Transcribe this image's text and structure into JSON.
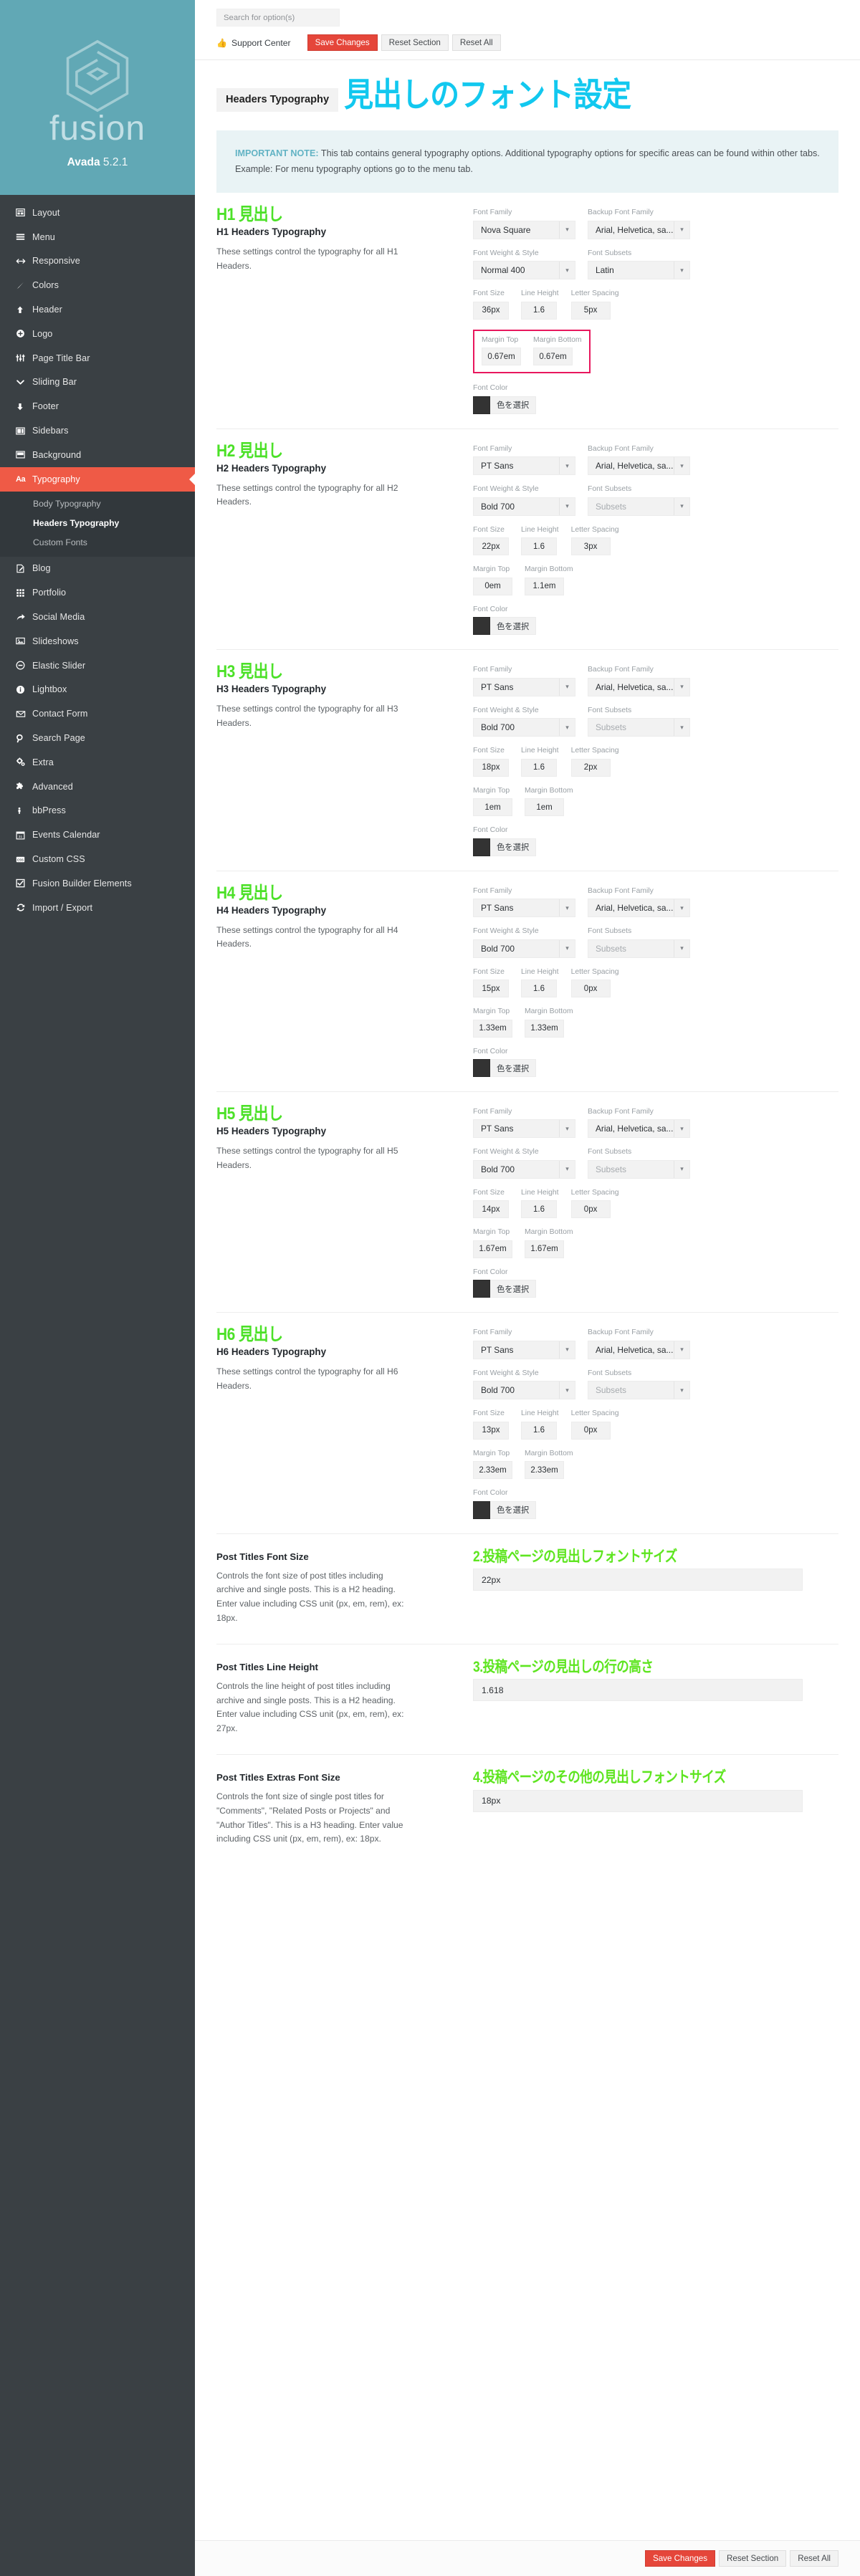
{
  "brand": {
    "name": "Avada",
    "version": "5.2.1",
    "wordmark": "fusion"
  },
  "sidebar": {
    "items": [
      {
        "label": "Layout",
        "icon": "layout-icon"
      },
      {
        "label": "Menu",
        "icon": "menu-icon"
      },
      {
        "label": "Responsive",
        "icon": "responsive-icon"
      },
      {
        "label": "Colors",
        "icon": "brush-icon"
      },
      {
        "label": "Header",
        "icon": "arrow-up-icon"
      },
      {
        "label": "Logo",
        "icon": "plus-circle-icon"
      },
      {
        "label": "Page Title Bar",
        "icon": "sliders-icon"
      },
      {
        "label": "Sliding Bar",
        "icon": "chevron-down-icon"
      },
      {
        "label": "Footer",
        "icon": "arrow-down-icon"
      },
      {
        "label": "Sidebars",
        "icon": "sidebars-icon"
      },
      {
        "label": "Background",
        "icon": "background-icon"
      }
    ],
    "active": {
      "label": "Typography",
      "icon": "aa-icon"
    },
    "subitems": [
      {
        "label": "Body Typography",
        "current": false
      },
      {
        "label": "Headers Typography",
        "current": true
      },
      {
        "label": "Custom Fonts",
        "current": false
      }
    ],
    "items_after": [
      {
        "label": "Blog",
        "icon": "blog-icon"
      },
      {
        "label": "Portfolio",
        "icon": "grid-icon"
      },
      {
        "label": "Social Media",
        "icon": "share-icon"
      },
      {
        "label": "Slideshows",
        "icon": "image-icon"
      },
      {
        "label": "Elastic Slider",
        "icon": "elastic-slider-icon"
      },
      {
        "label": "Lightbox",
        "icon": "info-circle-icon"
      },
      {
        "label": "Contact Form",
        "icon": "envelope-icon"
      },
      {
        "label": "Search Page",
        "icon": "search-icon"
      },
      {
        "label": "Extra",
        "icon": "gears-icon"
      },
      {
        "label": "Advanced",
        "icon": "puzzle-icon"
      },
      {
        "label": "bbPress",
        "icon": "person-icon"
      },
      {
        "label": "Events Calendar",
        "icon": "calendar-icon"
      },
      {
        "label": "Custom CSS",
        "icon": "css-icon"
      },
      {
        "label": "Fusion Builder Elements",
        "icon": "checkbox-icon"
      },
      {
        "label": "Import / Export",
        "icon": "refresh-icon"
      }
    ]
  },
  "search": {
    "placeholder": "Search for option(s)",
    "value": ""
  },
  "toolbar": {
    "support_label": "Support Center",
    "support_icon": "thumbs-up-icon",
    "save_label": "Save Changes",
    "reset_section_label": "Reset Section",
    "reset_all_label": "Reset All"
  },
  "page": {
    "tag": "Headers Typography",
    "jp_title": "見出しのフォント設定"
  },
  "notice": {
    "prefix": "IMPORTANT NOTE:",
    "body": " This tab contains general typography options. Additional typography options for specific areas can be found within other tabs. Example: For menu typography options go to the menu tab."
  },
  "labels": {
    "font_family": "Font Family",
    "backup_font_family": "Backup Font Family",
    "font_weight_style": "Font Weight & Style",
    "font_subsets": "Font Subsets",
    "font_size": "Font Size",
    "line_height": "Line Height",
    "letter_spacing": "Letter Spacing",
    "margin_top": "Margin Top",
    "margin_bottom": "Margin Bottom",
    "font_color": "Font Color",
    "color_button": "色を選択"
  },
  "sections": [
    {
      "jp": "H1 見出し",
      "title": "H1 Headers Typography",
      "desc": "These settings control the typography for all H1 Headers.",
      "font_family": "Nova Square",
      "backup_font_family": "Arial, Helvetica, sa...",
      "font_weight": "Normal 400",
      "font_subsets": "Latin",
      "font_subsets_placeholder": false,
      "font_size": "36px",
      "line_height": "1.6",
      "letter_spacing": "5px",
      "margin_top": "0.67em",
      "margin_bottom": "0.67em",
      "font_color": "#333333",
      "highlight_margins": true
    },
    {
      "jp": "H2 見出し",
      "title": "H2 Headers Typography",
      "desc": "These settings control the typography for all H2 Headers.",
      "font_family": "PT Sans",
      "backup_font_family": "Arial, Helvetica, sa...",
      "font_weight": "Bold 700",
      "font_subsets": "Subsets",
      "font_subsets_placeholder": true,
      "font_size": "22px",
      "line_height": "1.6",
      "letter_spacing": "3px",
      "margin_top": "0em",
      "margin_bottom": "1.1em",
      "font_color": "#333333",
      "highlight_margins": false
    },
    {
      "jp": "H3 見出し",
      "title": "H3 Headers Typography",
      "desc": "These settings control the typography for all H3 Headers.",
      "font_family": "PT Sans",
      "backup_font_family": "Arial, Helvetica, sa...",
      "font_weight": "Bold 700",
      "font_subsets": "Subsets",
      "font_subsets_placeholder": true,
      "font_size": "18px",
      "line_height": "1.6",
      "letter_spacing": "2px",
      "margin_top": "1em",
      "margin_bottom": "1em",
      "font_color": "#333333",
      "highlight_margins": false
    },
    {
      "jp": "H4 見出し",
      "title": "H4 Headers Typography",
      "desc": "These settings control the typography for all H4 Headers.",
      "font_family": "PT Sans",
      "backup_font_family": "Arial, Helvetica, sa...",
      "font_weight": "Bold 700",
      "font_subsets": "Subsets",
      "font_subsets_placeholder": true,
      "font_size": "15px",
      "line_height": "1.6",
      "letter_spacing": "0px",
      "margin_top": "1.33em",
      "margin_bottom": "1.33em",
      "font_color": "#333333",
      "highlight_margins": false
    },
    {
      "jp": "H5 見出し",
      "title": "H5 Headers Typography",
      "desc": "These settings control the typography for all H5 Headers.",
      "font_family": "PT Sans",
      "backup_font_family": "Arial, Helvetica, sa...",
      "font_weight": "Bold 700",
      "font_subsets": "Subsets",
      "font_subsets_placeholder": true,
      "font_size": "14px",
      "line_height": "1.6",
      "letter_spacing": "0px",
      "margin_top": "1.67em",
      "margin_bottom": "1.67em",
      "font_color": "#333333",
      "highlight_margins": false
    },
    {
      "jp": "H6 見出し",
      "title": "H6 Headers Typography",
      "desc": "These settings control the typography for all H6 Headers.",
      "font_family": "PT Sans",
      "backup_font_family": "Arial, Helvetica, sa...",
      "font_weight": "Bold 700",
      "font_subsets": "Subsets",
      "font_subsets_placeholder": true,
      "font_size": "13px",
      "line_height": "1.6",
      "letter_spacing": "0px",
      "margin_top": "2.33em",
      "margin_bottom": "2.33em",
      "font_color": "#333333",
      "highlight_margins": false
    }
  ],
  "post_rows": [
    {
      "title": "Post Titles Font Size",
      "desc": "Controls the font size of post titles including archive and single posts. This is a H2 heading. Enter value including CSS unit (px, em, rem), ex: 18px.",
      "jp_note": "2.投稿ページの見出しフォントサイズ",
      "value": "22px"
    },
    {
      "title": "Post Titles Line Height",
      "desc": "Controls the line height of post titles including archive and single posts. This is a H2 heading. Enter value including CSS unit (px, em, rem), ex: 27px.",
      "jp_note": "3.投稿ページの見出しの行の高さ",
      "value": "1.618"
    },
    {
      "title": "Post Titles Extras Font Size",
      "desc": "Controls the font size of single post titles for \"Comments\", \"Related Posts or Projects\" and \"Author Titles\". This is a H3 heading. Enter value including CSS unit (px, em, rem), ex: 18px.",
      "jp_note": "4.投稿ページのその他の見出しフォントサイズ",
      "value": "18px"
    }
  ]
}
